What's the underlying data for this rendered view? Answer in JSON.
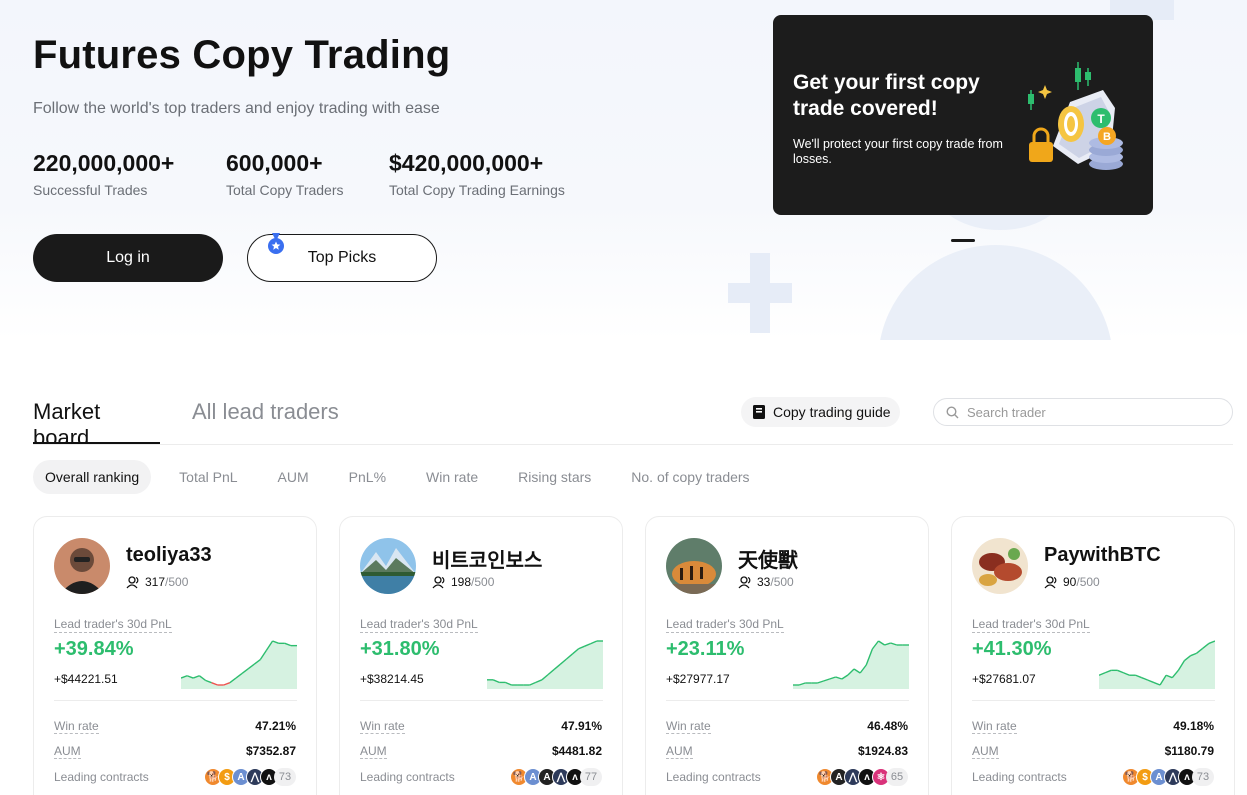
{
  "hero": {
    "title": "Futures Copy Trading",
    "subtitle": "Follow the world's top traders and enjoy trading with ease",
    "stats": [
      {
        "value": "220,000,000+",
        "label": "Successful Trades"
      },
      {
        "value": "600,000+",
        "label": "Total Copy Traders"
      },
      {
        "value": "$420,000,000+",
        "label": "Total Copy Trading Earnings"
      }
    ],
    "login_label": "Log in",
    "top_picks_label": "Top Picks"
  },
  "promo": {
    "title": "Get your first copy trade covered!",
    "text": "We'll protect your first copy trade from losses."
  },
  "board": {
    "tabs": [
      "Market board",
      "All lead traders"
    ],
    "guide_label": "Copy trading guide",
    "search_placeholder": "Search trader",
    "filters": [
      "Overall ranking",
      "Total PnL",
      "AUM",
      "PnL%",
      "Win rate",
      "Rising stars",
      "No. of copy traders"
    ]
  },
  "card_labels": {
    "pnl_label": "Lead trader's 30d PnL",
    "win_rate": "Win rate",
    "aum": "AUM",
    "contracts": "Leading contracts"
  },
  "traders": [
    {
      "name": "teoliya33",
      "copiers": "317",
      "capacity": "/500",
      "pnl_pct": "+39.84%",
      "pnl_usd": "+$44221.51",
      "win_rate": "47.21%",
      "aum": "$7352.87",
      "more_contracts": "73",
      "avatar": "person-portrait",
      "contracts": [
        "shiba",
        "dollar",
        "ada",
        "arbitrum",
        "arweave"
      ],
      "pnl_series": [
        2,
        3,
        2,
        3,
        1,
        0,
        -1,
        -1,
        0,
        2,
        4,
        6,
        8,
        10,
        14,
        18,
        17,
        17,
        16,
        16
      ]
    },
    {
      "name": "비트코인보스",
      "copiers": "198",
      "capacity": "/500",
      "pnl_pct": "+31.80%",
      "pnl_usd": "+$38214.45",
      "win_rate": "47.91%",
      "aum": "$4481.82",
      "more_contracts": "77",
      "avatar": "mountain-lake",
      "contracts": [
        "shiba",
        "ada",
        "apt",
        "arbitrum",
        "arweave"
      ],
      "pnl_series": [
        2,
        2,
        1,
        1,
        0,
        0,
        0,
        0,
        1,
        2,
        4,
        6,
        8,
        10,
        12,
        14,
        15,
        16,
        17,
        17
      ]
    },
    {
      "name": "天使獸",
      "copiers": "33",
      "capacity": "/500",
      "pnl_pct": "+23.11%",
      "pnl_usd": "+$27977.17",
      "win_rate": "46.48%",
      "aum": "$1924.83",
      "more_contracts": "65",
      "avatar": "tiger",
      "contracts": [
        "shiba",
        "apt",
        "arbitrum",
        "arweave",
        "atom"
      ],
      "pnl_series": [
        0,
        0,
        1,
        1,
        1,
        2,
        3,
        4,
        3,
        5,
        8,
        6,
        10,
        18,
        22,
        20,
        21,
        20,
        20,
        20
      ]
    },
    {
      "name": "PaywithBTC",
      "copiers": "90",
      "capacity": "/500",
      "pnl_pct": "+41.30%",
      "pnl_usd": "+$27681.07",
      "win_rate": "49.18%",
      "aum": "$1180.79",
      "more_contracts": "73",
      "avatar": "bbq-food",
      "contracts": [
        "shiba",
        "dollar",
        "ada",
        "arbitrum",
        "arweave"
      ],
      "pnl_series": [
        4,
        5,
        6,
        6,
        5,
        4,
        4,
        3,
        2,
        1,
        0,
        4,
        3,
        6,
        10,
        12,
        13,
        15,
        17,
        18
      ]
    }
  ],
  "colors": {
    "up": "#2dbd6e",
    "down": "#ef5350",
    "fill": "#d6f2e1",
    "dark": "#1a1a1a"
  }
}
